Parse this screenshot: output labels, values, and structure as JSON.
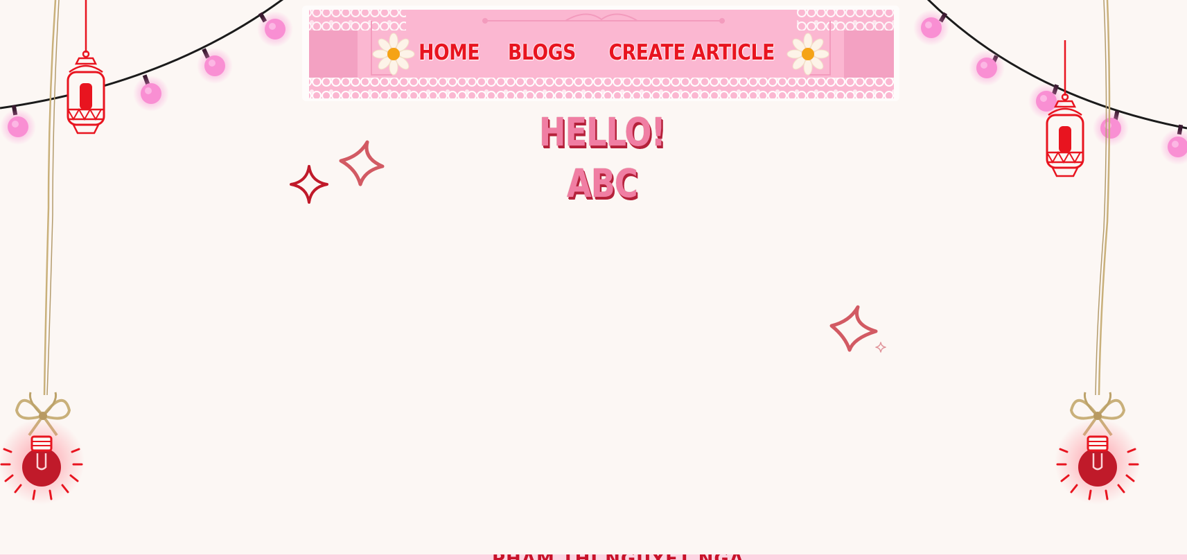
{
  "nav": {
    "links": [
      {
        "label": "HOME"
      },
      {
        "label": "BLOGS"
      },
      {
        "label": "CREATE ARTICLE"
      }
    ]
  },
  "greeting": {
    "line1": "HELLO!",
    "line2": "ABC"
  },
  "footer": {
    "text": "PHẠM THỊ NGUYỆT NGA"
  },
  "colors": {
    "background": "#fcf7f4",
    "nav_link": "#e8141f",
    "banner_pink": "#fbb7d1",
    "greeting_fill": "#f07ea3",
    "greeting_shadow": "#b5213a",
    "lantern_red": "#e8141f",
    "bulb_pink": "#f98fd3",
    "sparkle_rose": "#d25a63",
    "sparkle_red": "#c01a2a"
  },
  "icons": [
    "string-lights-left",
    "string-lights-right",
    "lantern-left",
    "lantern-right",
    "bulb-ornament-left",
    "bulb-ornament-right",
    "sparkle-icon",
    "daisy-icon",
    "lace-banner"
  ]
}
